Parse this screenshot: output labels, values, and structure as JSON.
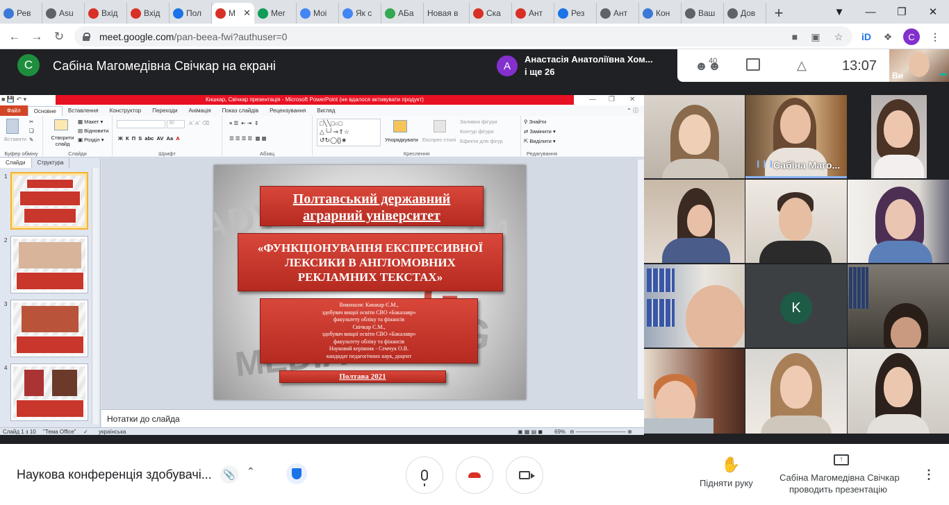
{
  "browser": {
    "tabs": [
      {
        "title": "Рев",
        "icon": "meet-icon",
        "color": "#3c78d8"
      },
      {
        "title": "Asu",
        "icon": "circle-icon",
        "color": "#5f6368"
      },
      {
        "title": "Вхід",
        "icon": "gmail-icon",
        "color": "#d93025"
      },
      {
        "title": "Вхід",
        "icon": "gmail-icon",
        "color": "#d93025"
      },
      {
        "title": "Пол",
        "icon": "calendar-icon",
        "color": "#1a73e8"
      },
      {
        "title": "M",
        "icon": "record-icon",
        "color": "#d93025",
        "active": true
      },
      {
        "title": "Mer",
        "icon": "meet-icon",
        "color": "#0f9d58"
      },
      {
        "title": "Moi",
        "icon": "forms-icon",
        "color": "#4285f4"
      },
      {
        "title": "Як с",
        "icon": "google-icon",
        "color": "#4285f4"
      },
      {
        "title": "АБа",
        "icon": "abc-icon",
        "color": "#34a853"
      },
      {
        "title": "Новая в",
        "icon": "",
        "color": ""
      },
      {
        "title": "Ска",
        "icon": "opera-icon",
        "color": "#d93025"
      },
      {
        "title": "Ант",
        "icon": "c-icon",
        "color": "#d93025"
      },
      {
        "title": "Рез",
        "icon": "chat-icon",
        "color": "#1a73e8"
      },
      {
        "title": "Ант",
        "icon": "eye-icon",
        "color": "#5f6368"
      },
      {
        "title": "Кон",
        "icon": "meet-icon",
        "color": "#3c78d8"
      },
      {
        "title": "Ваш",
        "icon": "badge-icon",
        "color": "#5f6368"
      },
      {
        "title": "Дов",
        "icon": "circle-icon",
        "color": "#5f6368"
      }
    ],
    "url_domain": "meet.google.com",
    "url_path": "/pan-beea-fwi?authuser=0",
    "profile_initial": "C"
  },
  "meet": {
    "presenter_initial": "C",
    "presenter_title": "Сабіна Магомедівна Свічкар на екрані",
    "notification_initial": "А",
    "notification_name": "Анастасія Анатоліївна Хом...",
    "notification_more": "і ще 26",
    "participants_count": "40",
    "clock": "13:07",
    "self_label": "Ви",
    "meeting_title": "Наукова конференція здобувачі...",
    "raise_hand": "Підняти руку",
    "presenting_line1": "Сабіна Магомедівна Свічкар",
    "presenting_line2": "проводить презентацію"
  },
  "ppt": {
    "window_title": "Кишкар, Свічкар презентація - Microsoft PowerPoint (не вдалося активувати продукт)",
    "tabs": [
      "Файл",
      "Основне",
      "Вставлення",
      "Конструктор",
      "Переходи",
      "Анімація",
      "Показ слайдів",
      "Рецензування",
      "Вигляд"
    ],
    "ribbon": {
      "paste": "Вставити",
      "clipboard": "Буфер обміну",
      "new_slide": "Створити слайд",
      "layout": "Макет",
      "reset": "Відновити",
      "section": "Розділ",
      "slides_group": "Слайди",
      "font_group": "Шрифт",
      "font_size": "30",
      "paragraph_group": "Абзац",
      "arrange": "Упорядкувати",
      "quick_styles": "Експрес-стилі",
      "shape_fill": "Заливка фігури",
      "shape_outline": "Контур фігури",
      "shape_effects": "Ефекти для фігур",
      "drawing_group": "Креслення",
      "find": "Знайти",
      "replace": "Замінити",
      "select": "Виділити",
      "editing_group": "Редагування"
    },
    "pane_tabs": [
      "Слайди",
      "Структура"
    ],
    "thumb_numbers": [
      "1",
      "2",
      "3",
      "4"
    ],
    "slide": {
      "university": "Полтавський державний аграрний університет",
      "topic": "«ФУНКЦІОНУВАННЯ ЕКСПРЕСИВНОЇ ЛЕКСИКИ В АНГЛОМОВНИХ РЕКЛАМНИХ ТЕКСТАХ»",
      "authors": [
        "Виконали: Кишкар Є.М.,",
        "здобувач вищої освіти СВО «Бакалавр»",
        "факультету обліку та фінансів",
        "Свічкар С.М.,",
        "здобувач вищої освіти СВО «Бакалавр»",
        "факультету обліку та фінансів",
        "Науковий керівник - Семчук О.В.",
        "кандидат педагогічних наук, доцент"
      ],
      "city_year": "Полтава 2021"
    },
    "notes_placeholder": "Нотатки до слайда",
    "status": {
      "slide_of": "Слайд 1 з 10",
      "theme": "\"Тема Office\"",
      "language": "українська",
      "zoom": "69%"
    }
  },
  "grid": {
    "speaker_name": "Сабіна Маго...",
    "k_initial": "K"
  }
}
